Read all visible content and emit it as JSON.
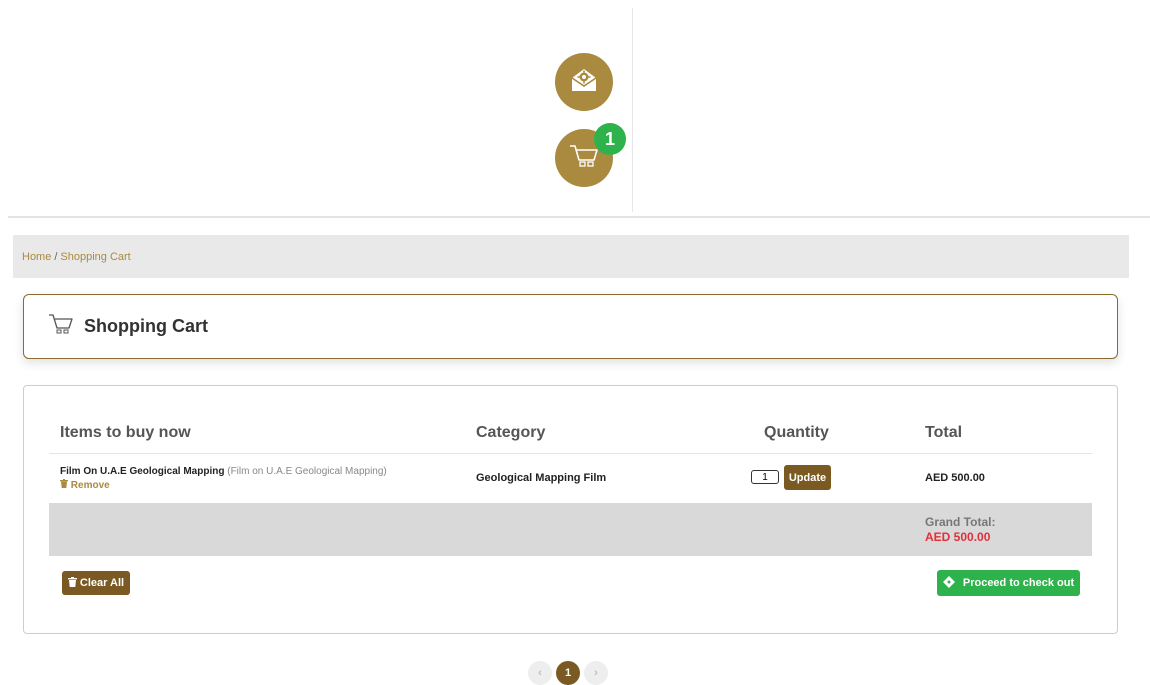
{
  "header": {
    "mail_icon": "mail-gear-icon",
    "cart_icon": "cart-icon",
    "cart_badge": "1"
  },
  "breadcrumb": {
    "home": "Home",
    "separator": "/",
    "current": "Shopping Cart"
  },
  "page": {
    "title": "Shopping Cart",
    "title_icon": "cart-icon"
  },
  "cart": {
    "columns": [
      "Items to buy now",
      "Category",
      "Quantity",
      "Total"
    ],
    "items": [
      {
        "name": "Film On U.A.E Geological Mapping",
        "subtitle": "(Film on U.A.E Geological Mapping)",
        "remove_label": "Remove",
        "category": "Geological Mapping Film",
        "quantity": "1",
        "update_label": "Update",
        "total": "AED 500.00"
      }
    ],
    "grand_total_label": "Grand Total:",
    "grand_total_value": "AED 500.00",
    "clear_all_label": "Clear All",
    "checkout_label": "Proceed to check out"
  },
  "pagination": {
    "prev": "‹",
    "current": "1",
    "next": "›"
  },
  "colors": {
    "brand_gold": "#a98a3f",
    "brand_brown": "#7a5a22",
    "accent_green": "#2eb24b",
    "price_red": "#e0303a"
  }
}
